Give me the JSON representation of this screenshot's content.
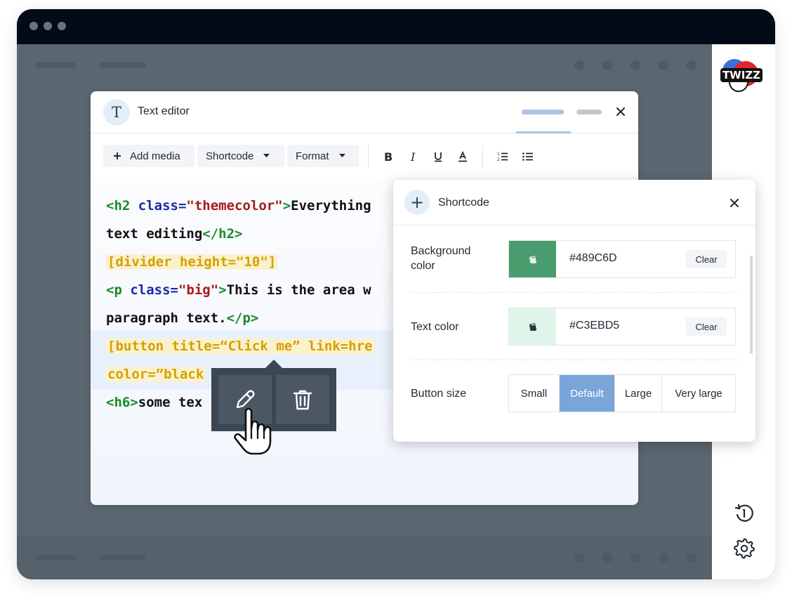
{
  "brand": {
    "logo_text": "TWIZZ"
  },
  "editor": {
    "title_icon_glyph": "T",
    "title": "Text editor",
    "toolbar": {
      "add_media": "Add media",
      "shortcode": "Shortcode",
      "format": "Format"
    },
    "code_lines": [
      {
        "parts": [
          {
            "t": "<h2 ",
            "c": "tag"
          },
          {
            "t": "class=",
            "c": "attr"
          },
          {
            "t": "\"themecolor\"",
            "c": "str"
          },
          {
            "t": ">",
            "c": "tag"
          },
          {
            "t": "Everything",
            "c": "txt"
          }
        ]
      },
      {
        "parts": [
          {
            "t": "text editing",
            "c": "txt"
          },
          {
            "t": "</h2>",
            "c": "tag"
          }
        ]
      },
      {
        "parts": [
          {
            "t": "[divider height=\"10\"]",
            "c": "sc"
          }
        ]
      },
      {
        "parts": [
          {
            "t": "<p ",
            "c": "tag"
          },
          {
            "t": "class=",
            "c": "attr"
          },
          {
            "t": "\"big\"",
            "c": "str"
          },
          {
            "t": ">",
            "c": "tag"
          },
          {
            "t": "This is the area w",
            "c": "txt"
          }
        ]
      },
      {
        "parts": [
          {
            "t": "paragraph text.",
            "c": "txt"
          },
          {
            "t": "</p>",
            "c": "tag"
          }
        ]
      },
      {
        "parts": [
          {
            "t": "[button title=“Click me” link=hre",
            "c": "sc"
          }
        ]
      },
      {
        "parts": [
          {
            "t": "color=”black",
            "c": "sc"
          }
        ]
      },
      {
        "parts": [
          {
            "t": "<h6>",
            "c": "tag"
          },
          {
            "t": "some tex",
            "c": "txt"
          }
        ]
      }
    ],
    "popover": {
      "edit_icon": "pencil-icon",
      "delete_icon": "trash-icon"
    }
  },
  "shortcode_panel": {
    "title": "Shortcode",
    "rows": {
      "background_color": {
        "label": "Background color",
        "value": "#489C6D",
        "clear": "Clear",
        "swatch": "#489C6D"
      },
      "text_color": {
        "label": "Text color",
        "value": "#C3EBD5",
        "clear": "Clear",
        "swatch": "#dff5e9"
      },
      "button_size": {
        "label": "Button size",
        "options": [
          "Small",
          "Default",
          "Large",
          "Very large"
        ],
        "selected": "Default"
      }
    }
  },
  "colors": {
    "titlebar": "#030a18",
    "overlay": "#5b6770",
    "accent_active": "#79a5d9",
    "tag": "#1a8a2a",
    "attr": "#1a2aa8",
    "string": "#a61b1b",
    "shortcode": "#d4a000"
  }
}
